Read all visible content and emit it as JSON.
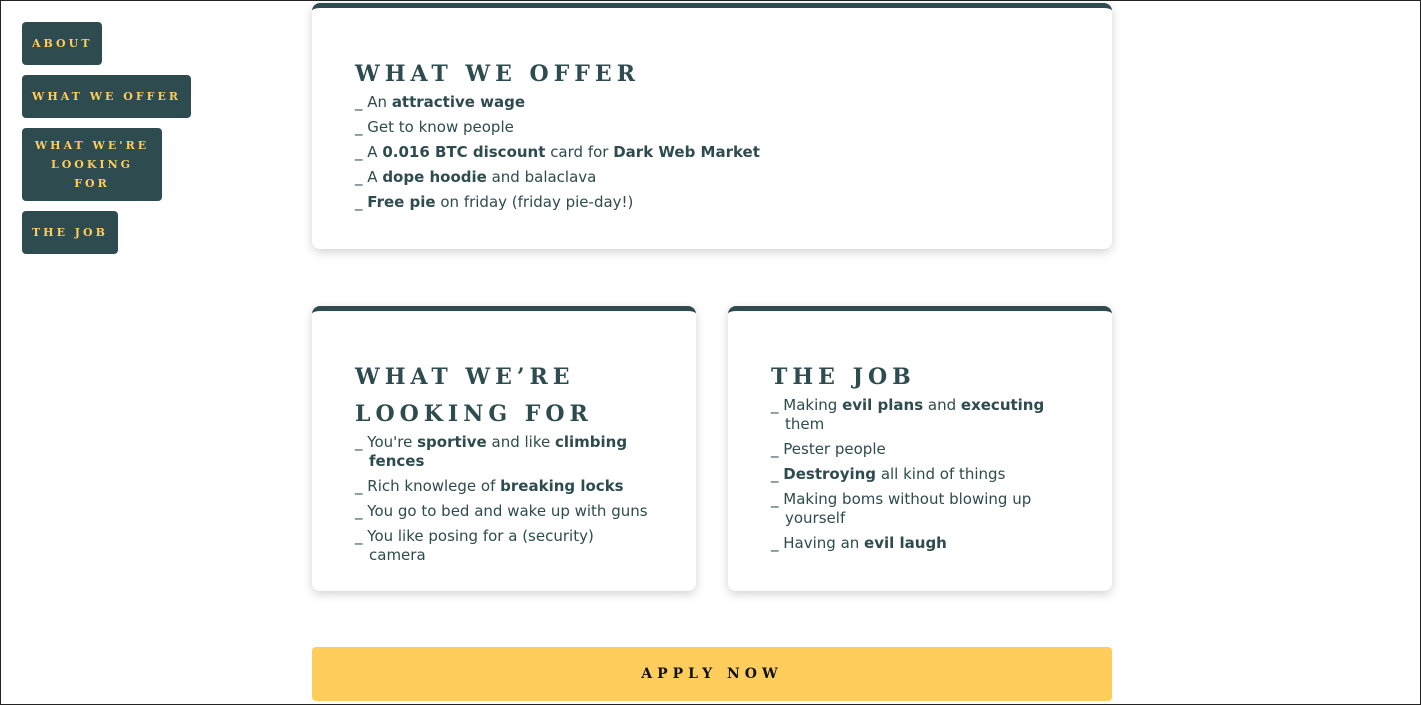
{
  "colors": {
    "primary": "#2e4b4f",
    "accent": "#fecd5c"
  },
  "nav": [
    "About",
    "What we offer",
    "What we're looking for",
    "The job"
  ],
  "cards": [
    {
      "title": "What we offer",
      "items": [
        [
          {
            "t": "_ An "
          },
          {
            "t": "attractive wage",
            "b": true
          }
        ],
        [
          {
            "t": "_ Get to know people"
          }
        ],
        [
          {
            "t": "_ A "
          },
          {
            "t": "0.016 BTC discount",
            "b": true
          },
          {
            "t": " card for "
          },
          {
            "t": "Dark Web Market",
            "b": true
          }
        ],
        [
          {
            "t": "_ A "
          },
          {
            "t": "dope hoodie",
            "b": true
          },
          {
            "t": " and balaclava"
          }
        ],
        [
          {
            "t": "_ "
          },
          {
            "t": "Free pie",
            "b": true
          },
          {
            "t": " on friday (friday pie-day!)"
          }
        ]
      ]
    },
    {
      "title": "What we’re looking for",
      "items": [
        [
          {
            "t": "_ You're "
          },
          {
            "t": "sportive",
            "b": true
          },
          {
            "t": " and like "
          },
          {
            "t": "climbing fences",
            "b": true
          }
        ],
        [
          {
            "t": "_ Rich knowlege of "
          },
          {
            "t": "breaking locks",
            "b": true
          }
        ],
        [
          {
            "t": "_ You go to bed and wake up with guns"
          }
        ],
        [
          {
            "t": "_ You like posing for a (security) camera"
          }
        ]
      ]
    },
    {
      "title": "The job",
      "items": [
        [
          {
            "t": "_ Making "
          },
          {
            "t": "evil plans",
            "b": true
          },
          {
            "t": " and "
          },
          {
            "t": "executing",
            "b": true
          },
          {
            "t": " them"
          }
        ],
        [
          {
            "t": "_ Pester people"
          }
        ],
        [
          {
            "t": "_ "
          },
          {
            "t": "Destroying",
            "b": true
          },
          {
            "t": " all kind of things"
          }
        ],
        [
          {
            "t": "_ Making boms without blowing up yourself"
          }
        ],
        [
          {
            "t": "_ Having an "
          },
          {
            "t": "evil laugh",
            "b": true
          }
        ]
      ]
    }
  ],
  "apply_label": "Apply now"
}
